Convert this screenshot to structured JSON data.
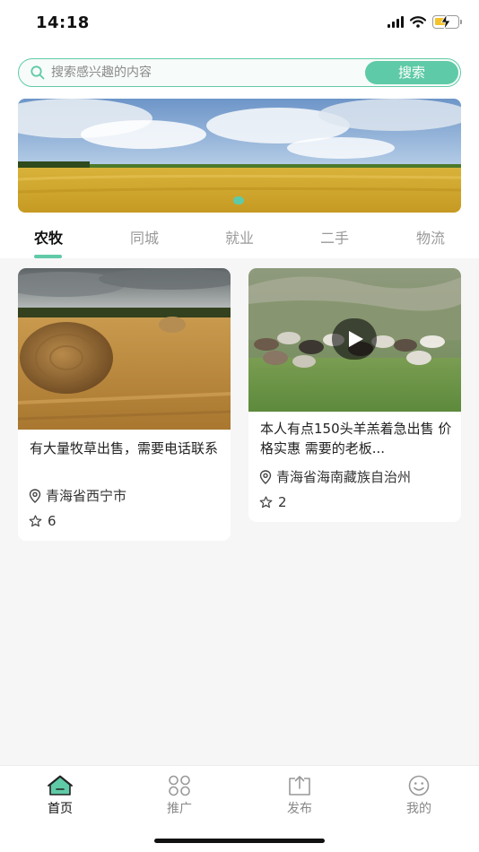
{
  "status_bar": {
    "time": "14:18"
  },
  "search": {
    "placeholder": "搜索感兴趣的内容",
    "button_label": "搜索"
  },
  "banner": {
    "slide_count": 1,
    "active_slide": 1
  },
  "tabs": [
    {
      "label": "农牧",
      "active": true
    },
    {
      "label": "同城",
      "active": false
    },
    {
      "label": "就业",
      "active": false
    },
    {
      "label": "二手",
      "active": false
    },
    {
      "label": "物流",
      "active": false
    }
  ],
  "cards": [
    {
      "title": "有大量牧草出售，需要电话联系",
      "location": "青海省西宁市",
      "stars": "6",
      "is_video": false
    },
    {
      "title": "本人有点150头羊羔着急出售 价格实惠 需要的老板...",
      "location": "青海省海南藏族自治州",
      "stars": "2",
      "is_video": true
    }
  ],
  "bottom_nav": [
    {
      "label": "首页",
      "icon": "home-icon",
      "active": true
    },
    {
      "label": "推广",
      "icon": "grid-icon",
      "active": false
    },
    {
      "label": "发布",
      "icon": "upload-icon",
      "active": false
    },
    {
      "label": "我的",
      "icon": "smiley-icon",
      "active": false
    }
  ],
  "colors": {
    "accent": "#5fcaa7",
    "page_background": "#f6f6f6"
  }
}
